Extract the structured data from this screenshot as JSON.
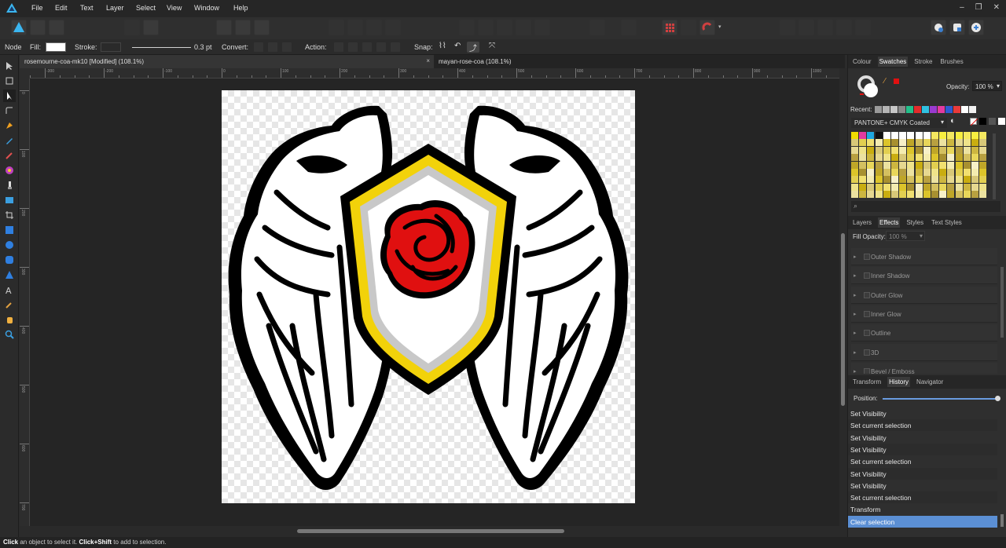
{
  "menubar": {
    "items": [
      "File",
      "Edit",
      "Text",
      "Layer",
      "Select",
      "View",
      "Window",
      "Help"
    ]
  },
  "context": {
    "node_label": "Node",
    "fill_label": "Fill:",
    "stroke_label": "Stroke:",
    "stroke_width": "0.3 pt",
    "convert_label": "Convert:",
    "action_label": "Action:",
    "snap_label": "Snap:"
  },
  "doc_tabs": [
    {
      "title": "rosemourne-coa-mk10 [Modified] (108.1%)",
      "close": "×"
    },
    {
      "title": "mayan-rose-coa (108.1%)"
    }
  ],
  "ruler": {
    "h_labels": [
      "-300",
      "-200",
      "-100",
      "0",
      "100",
      "200",
      "300",
      "400",
      "500",
      "600",
      "700",
      "800",
      "900",
      "1000"
    ],
    "v_labels": [
      "0",
      "100",
      "200",
      "300",
      "400",
      "500",
      "600",
      "700"
    ]
  },
  "panel_top": {
    "tabs": [
      "Colour",
      "Swatches",
      "Stroke",
      "Brushes"
    ],
    "active_tab": "Swatches",
    "opacity_label": "Opacity:",
    "opacity_value": "100 %",
    "recent_label": "Recent:",
    "recent_colors": [
      "#9a9a9a",
      "#b5b5b5",
      "#c7c7c7",
      "#8a8a8a",
      "#22c08a",
      "#e32b2b",
      "#2fc0e0",
      "#9a3ad0",
      "#e23aa0",
      "#2e5ad0",
      "#e83a3a",
      "#ffffff",
      "#f2f2f2"
    ],
    "palette_name": "PANTONE+ CMYK Coated",
    "palette_first_row": [
      "#f1dd00",
      "#e23aa0",
      "#1fa8e0",
      "#111111"
    ]
  },
  "panel_mid": {
    "tabs": [
      "Layers",
      "Effects",
      "Styles",
      "Text Styles"
    ],
    "active_tab": "Effects",
    "fill_opacity_label": "Fill Opacity:",
    "fill_opacity_value": "100 %",
    "effects": [
      "Outer Shadow",
      "Inner Shadow",
      "Outer Glow",
      "Inner Glow",
      "Outline",
      "3D",
      "Bevel / Emboss"
    ]
  },
  "panel_bottom": {
    "tabs": [
      "Transform",
      "History",
      "Navigator"
    ],
    "active_tab": "History",
    "position_label": "Position:",
    "history": [
      "Set Visibility",
      "Set current selection",
      "Set Visibility",
      "Set Visibility",
      "Set current selection",
      "Set Visibility",
      "Set Visibility",
      "Set current selection",
      "Transform",
      "Clear selection"
    ],
    "selected_index": 9
  },
  "status": {
    "click": "Click",
    "t1": " an object to select it. ",
    "click_shift": "Click+Shift",
    "t2": " to add to selection."
  },
  "colors": {
    "rose_red": "#e01010",
    "shield_gold": "#f2d20a",
    "selection_blue": "#5b8fd4"
  }
}
